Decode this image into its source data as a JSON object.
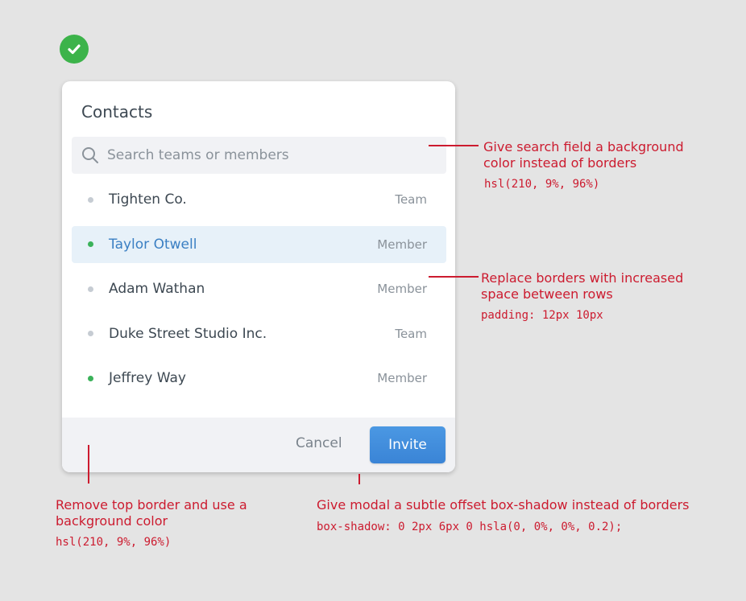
{
  "modal": {
    "title": "Contacts",
    "search_placeholder": "Search teams or members",
    "rows": [
      {
        "name": "Tighten Co.",
        "type": "Team",
        "status": "offline",
        "selected": false
      },
      {
        "name": "Taylor Otwell",
        "type": "Member",
        "status": "online",
        "selected": true
      },
      {
        "name": "Adam Wathan",
        "type": "Member",
        "status": "offline",
        "selected": false
      },
      {
        "name": "Duke Street Studio Inc.",
        "type": "Team",
        "status": "offline",
        "selected": false
      },
      {
        "name": "Jeffrey Way",
        "type": "Member",
        "status": "online",
        "selected": false
      }
    ],
    "cancel_label": "Cancel",
    "invite_label": "Invite"
  },
  "annotations": {
    "search": {
      "text": "Give search field a background color instead of borders",
      "code": "hsl(210, 9%, 96%)"
    },
    "rows": {
      "text": "Replace borders with increased space between rows",
      "code": "padding: 12px 10px"
    },
    "footer": {
      "text": "Remove top border and use a background color",
      "code": "hsl(210, 9%, 96%)"
    },
    "shadow": {
      "text": "Give modal a subtle offset box-shadow instead of borders",
      "code": "box-shadow: 0 2px 6px 0 hsla(0, 0%, 0%, 0.2);"
    }
  },
  "colors": {
    "accent": "#3a7fc3",
    "online": "#3bb25a",
    "annotation": "#cc1b2f",
    "panel_bg": "#f1f2f5"
  }
}
